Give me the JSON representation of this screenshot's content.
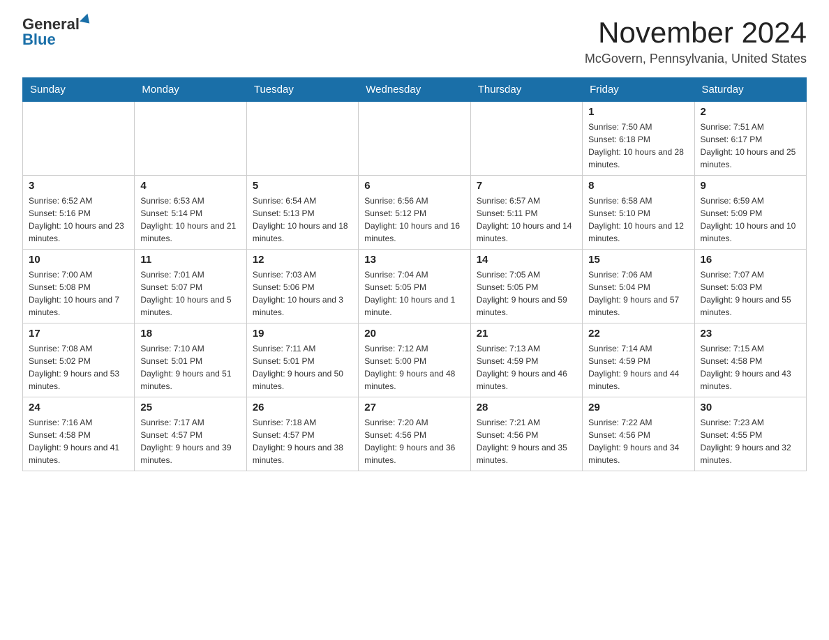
{
  "header": {
    "logo_general": "General",
    "logo_blue": "Blue",
    "month_title": "November 2024",
    "location": "McGovern, Pennsylvania, United States"
  },
  "days_of_week": [
    "Sunday",
    "Monday",
    "Tuesday",
    "Wednesday",
    "Thursday",
    "Friday",
    "Saturday"
  ],
  "weeks": [
    {
      "days": [
        {
          "number": "",
          "info": ""
        },
        {
          "number": "",
          "info": ""
        },
        {
          "number": "",
          "info": ""
        },
        {
          "number": "",
          "info": ""
        },
        {
          "number": "",
          "info": ""
        },
        {
          "number": "1",
          "info": "Sunrise: 7:50 AM\nSunset: 6:18 PM\nDaylight: 10 hours and 28 minutes."
        },
        {
          "number": "2",
          "info": "Sunrise: 7:51 AM\nSunset: 6:17 PM\nDaylight: 10 hours and 25 minutes."
        }
      ]
    },
    {
      "days": [
        {
          "number": "3",
          "info": "Sunrise: 6:52 AM\nSunset: 5:16 PM\nDaylight: 10 hours and 23 minutes."
        },
        {
          "number": "4",
          "info": "Sunrise: 6:53 AM\nSunset: 5:14 PM\nDaylight: 10 hours and 21 minutes."
        },
        {
          "number": "5",
          "info": "Sunrise: 6:54 AM\nSunset: 5:13 PM\nDaylight: 10 hours and 18 minutes."
        },
        {
          "number": "6",
          "info": "Sunrise: 6:56 AM\nSunset: 5:12 PM\nDaylight: 10 hours and 16 minutes."
        },
        {
          "number": "7",
          "info": "Sunrise: 6:57 AM\nSunset: 5:11 PM\nDaylight: 10 hours and 14 minutes."
        },
        {
          "number": "8",
          "info": "Sunrise: 6:58 AM\nSunset: 5:10 PM\nDaylight: 10 hours and 12 minutes."
        },
        {
          "number": "9",
          "info": "Sunrise: 6:59 AM\nSunset: 5:09 PM\nDaylight: 10 hours and 10 minutes."
        }
      ]
    },
    {
      "days": [
        {
          "number": "10",
          "info": "Sunrise: 7:00 AM\nSunset: 5:08 PM\nDaylight: 10 hours and 7 minutes."
        },
        {
          "number": "11",
          "info": "Sunrise: 7:01 AM\nSunset: 5:07 PM\nDaylight: 10 hours and 5 minutes."
        },
        {
          "number": "12",
          "info": "Sunrise: 7:03 AM\nSunset: 5:06 PM\nDaylight: 10 hours and 3 minutes."
        },
        {
          "number": "13",
          "info": "Sunrise: 7:04 AM\nSunset: 5:05 PM\nDaylight: 10 hours and 1 minute."
        },
        {
          "number": "14",
          "info": "Sunrise: 7:05 AM\nSunset: 5:05 PM\nDaylight: 9 hours and 59 minutes."
        },
        {
          "number": "15",
          "info": "Sunrise: 7:06 AM\nSunset: 5:04 PM\nDaylight: 9 hours and 57 minutes."
        },
        {
          "number": "16",
          "info": "Sunrise: 7:07 AM\nSunset: 5:03 PM\nDaylight: 9 hours and 55 minutes."
        }
      ]
    },
    {
      "days": [
        {
          "number": "17",
          "info": "Sunrise: 7:08 AM\nSunset: 5:02 PM\nDaylight: 9 hours and 53 minutes."
        },
        {
          "number": "18",
          "info": "Sunrise: 7:10 AM\nSunset: 5:01 PM\nDaylight: 9 hours and 51 minutes."
        },
        {
          "number": "19",
          "info": "Sunrise: 7:11 AM\nSunset: 5:01 PM\nDaylight: 9 hours and 50 minutes."
        },
        {
          "number": "20",
          "info": "Sunrise: 7:12 AM\nSunset: 5:00 PM\nDaylight: 9 hours and 48 minutes."
        },
        {
          "number": "21",
          "info": "Sunrise: 7:13 AM\nSunset: 4:59 PM\nDaylight: 9 hours and 46 minutes."
        },
        {
          "number": "22",
          "info": "Sunrise: 7:14 AM\nSunset: 4:59 PM\nDaylight: 9 hours and 44 minutes."
        },
        {
          "number": "23",
          "info": "Sunrise: 7:15 AM\nSunset: 4:58 PM\nDaylight: 9 hours and 43 minutes."
        }
      ]
    },
    {
      "days": [
        {
          "number": "24",
          "info": "Sunrise: 7:16 AM\nSunset: 4:58 PM\nDaylight: 9 hours and 41 minutes."
        },
        {
          "number": "25",
          "info": "Sunrise: 7:17 AM\nSunset: 4:57 PM\nDaylight: 9 hours and 39 minutes."
        },
        {
          "number": "26",
          "info": "Sunrise: 7:18 AM\nSunset: 4:57 PM\nDaylight: 9 hours and 38 minutes."
        },
        {
          "number": "27",
          "info": "Sunrise: 7:20 AM\nSunset: 4:56 PM\nDaylight: 9 hours and 36 minutes."
        },
        {
          "number": "28",
          "info": "Sunrise: 7:21 AM\nSunset: 4:56 PM\nDaylight: 9 hours and 35 minutes."
        },
        {
          "number": "29",
          "info": "Sunrise: 7:22 AM\nSunset: 4:56 PM\nDaylight: 9 hours and 34 minutes."
        },
        {
          "number": "30",
          "info": "Sunrise: 7:23 AM\nSunset: 4:55 PM\nDaylight: 9 hours and 32 minutes."
        }
      ]
    }
  ]
}
